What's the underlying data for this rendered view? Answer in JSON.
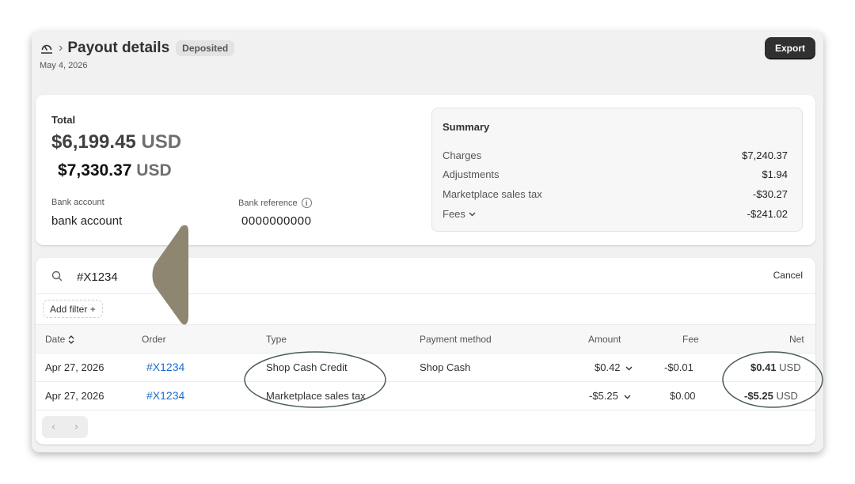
{
  "header": {
    "title": "Payout details",
    "status": "Deposited",
    "date": "May 4, 2026",
    "export_label": "Export",
    "breadcrumb_sep": "›"
  },
  "total": {
    "label": "Total",
    "amount": "$6,199.45",
    "currency": "USD",
    "amount_alt": "$7,330.37",
    "currency_alt": "USD",
    "bank_account_label": "Bank account",
    "bank_account_value": "bank account",
    "bank_reference_label": "Bank reference",
    "bank_reference_value": "0000000000"
  },
  "summary": {
    "title": "Summary",
    "rows": [
      {
        "label": "Charges",
        "value": "$7,240.37"
      },
      {
        "label": "Adjustments",
        "value": "$1.94"
      },
      {
        "label": "Marketplace sales tax",
        "value": "-$30.27"
      },
      {
        "label": "Fees",
        "value": "-$241.02"
      }
    ]
  },
  "search": {
    "value": "#X1234",
    "cancel_label": "Cancel",
    "add_filter_label": "Add filter +"
  },
  "table": {
    "columns": [
      "Date",
      "Order",
      "Type",
      "Payment method",
      "Amount",
      "Fee",
      "Net"
    ],
    "rows": [
      {
        "date": "Apr 27, 2026",
        "order": "#X1234",
        "type": "Shop Cash Credit",
        "payment_method": "Shop Cash",
        "amount": "$0.42",
        "fee": "-$0.01",
        "net": "$0.41",
        "currency": "USD"
      },
      {
        "date": "Apr 27, 2026",
        "order": "#X1234",
        "type": "Marketplace sales tax",
        "payment_method": "",
        "amount": "-$5.25",
        "fee": "$0.00",
        "net": "-$5.25",
        "currency": "USD"
      }
    ]
  },
  "pager": {
    "prev": "‹",
    "next": "›"
  },
  "colors": {
    "annotation_ellipse": "#4a5e50",
    "annotation_pointer": "#8e8670",
    "link": "#1b6dce",
    "primary_button": "#303030"
  }
}
